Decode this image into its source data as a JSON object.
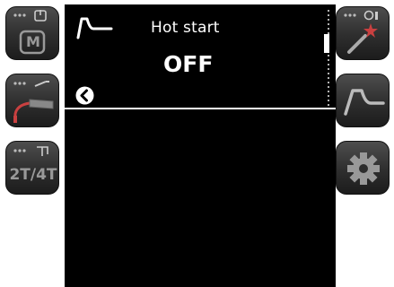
{
  "screen": {
    "title": "Hot start",
    "value": "OFF"
  },
  "left_buttons": {
    "mode_memory": {
      "label": "M",
      "icon": "memory-power-icon"
    },
    "torch": {
      "icon": "torch-icon"
    },
    "trigger_mode": {
      "label": "2T/4T",
      "icon": "trigger-icon"
    }
  },
  "right_buttons": {
    "wizard": {
      "icon": "wizard-wand-icon"
    },
    "curve": {
      "icon": "curve-icon"
    },
    "settings": {
      "icon": "gear-icon"
    }
  },
  "colors": {
    "screen_bg": "#000000",
    "text": "#ffffff",
    "button_bg": "#3a3a3a"
  }
}
